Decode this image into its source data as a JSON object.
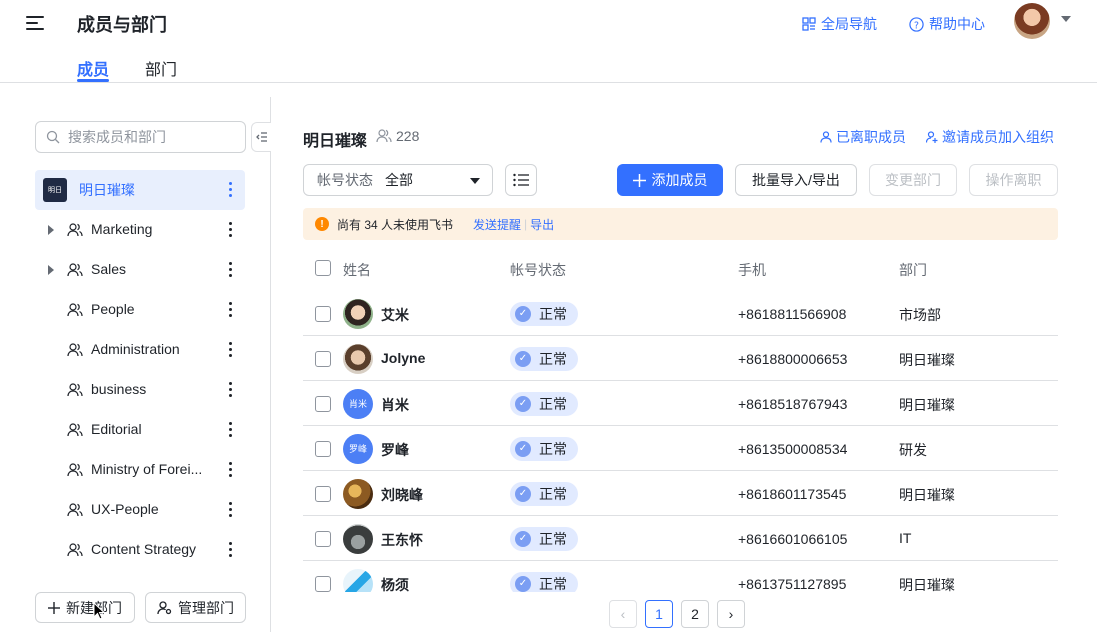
{
  "header": {
    "title": "成员与部门",
    "global_nav": "全局导航",
    "help_center": "帮助中心"
  },
  "tabs": [
    "成员",
    "部门"
  ],
  "sidebar": {
    "search_placeholder": "搜索成员和部门",
    "org": {
      "logo_text": "明日",
      "name": "明日璀璨"
    },
    "departments": [
      {
        "label": "Marketing",
        "expandable": true
      },
      {
        "label": "Sales",
        "expandable": true
      },
      {
        "label": "People",
        "expandable": false
      },
      {
        "label": "Administration",
        "expandable": false
      },
      {
        "label": "business",
        "expandable": false
      },
      {
        "label": "Editorial",
        "expandable": false
      },
      {
        "label": "Ministry of Forei...",
        "expandable": false
      },
      {
        "label": "UX-People",
        "expandable": false
      },
      {
        "label": "Content Strategy",
        "expandable": false
      }
    ],
    "new_dept_button": "新建部门",
    "manage_dept_button": "管理部门"
  },
  "main": {
    "org_name": "明日璀璨",
    "member_count": "228",
    "departed_link": "已离职成员",
    "invite_link": "邀请成员加入组织",
    "filter": {
      "label": "帐号状态",
      "value": "全部"
    },
    "add_member_button": "添加成员",
    "import_export_button": "批量导入/导出",
    "change_dept_button": "变更部门",
    "offboard_button": "操作离职",
    "notice": {
      "text": "尚有 34 人未使用飞书",
      "remind_link": "发送提醒",
      "export_link": "导出"
    },
    "table": {
      "headers": [
        "姓名",
        "帐号状态",
        "手机",
        "部门"
      ],
      "rows": [
        {
          "name": "艾米",
          "avatar": "photo",
          "status": "正常",
          "phone": "+8618811566908",
          "dept": "市场部"
        },
        {
          "name": "Jolyne",
          "avatar": "photo",
          "status": "正常",
          "phone": "+8618800006653",
          "dept": "明日璀璨"
        },
        {
          "name": "肖米",
          "avatar": "肖米",
          "status": "正常",
          "phone": "+8618518767943",
          "dept": "明日璀璨"
        },
        {
          "name": "罗峰",
          "avatar": "罗峰",
          "status": "正常",
          "phone": "+8613500008534",
          "dept": "研发"
        },
        {
          "name": "刘晓峰",
          "avatar": "photo",
          "status": "正常",
          "phone": "+8618601173545",
          "dept": "明日璀璨"
        },
        {
          "name": "王东怀",
          "avatar": "photo",
          "status": "正常",
          "phone": "+8616601066105",
          "dept": "IT"
        },
        {
          "name": "杨须",
          "avatar": "photo",
          "status": "正常",
          "phone": "+8613751127895",
          "dept": "明日璀璨"
        }
      ]
    },
    "pagination": {
      "pages": [
        "1",
        "2"
      ],
      "current": "1",
      "prev": "‹",
      "next": "›"
    }
  },
  "colors": {
    "accent": "#3370ff",
    "notice_bg": "#fdf1e2",
    "warning": "#ff8800",
    "status_bg": "#e1eaff"
  }
}
